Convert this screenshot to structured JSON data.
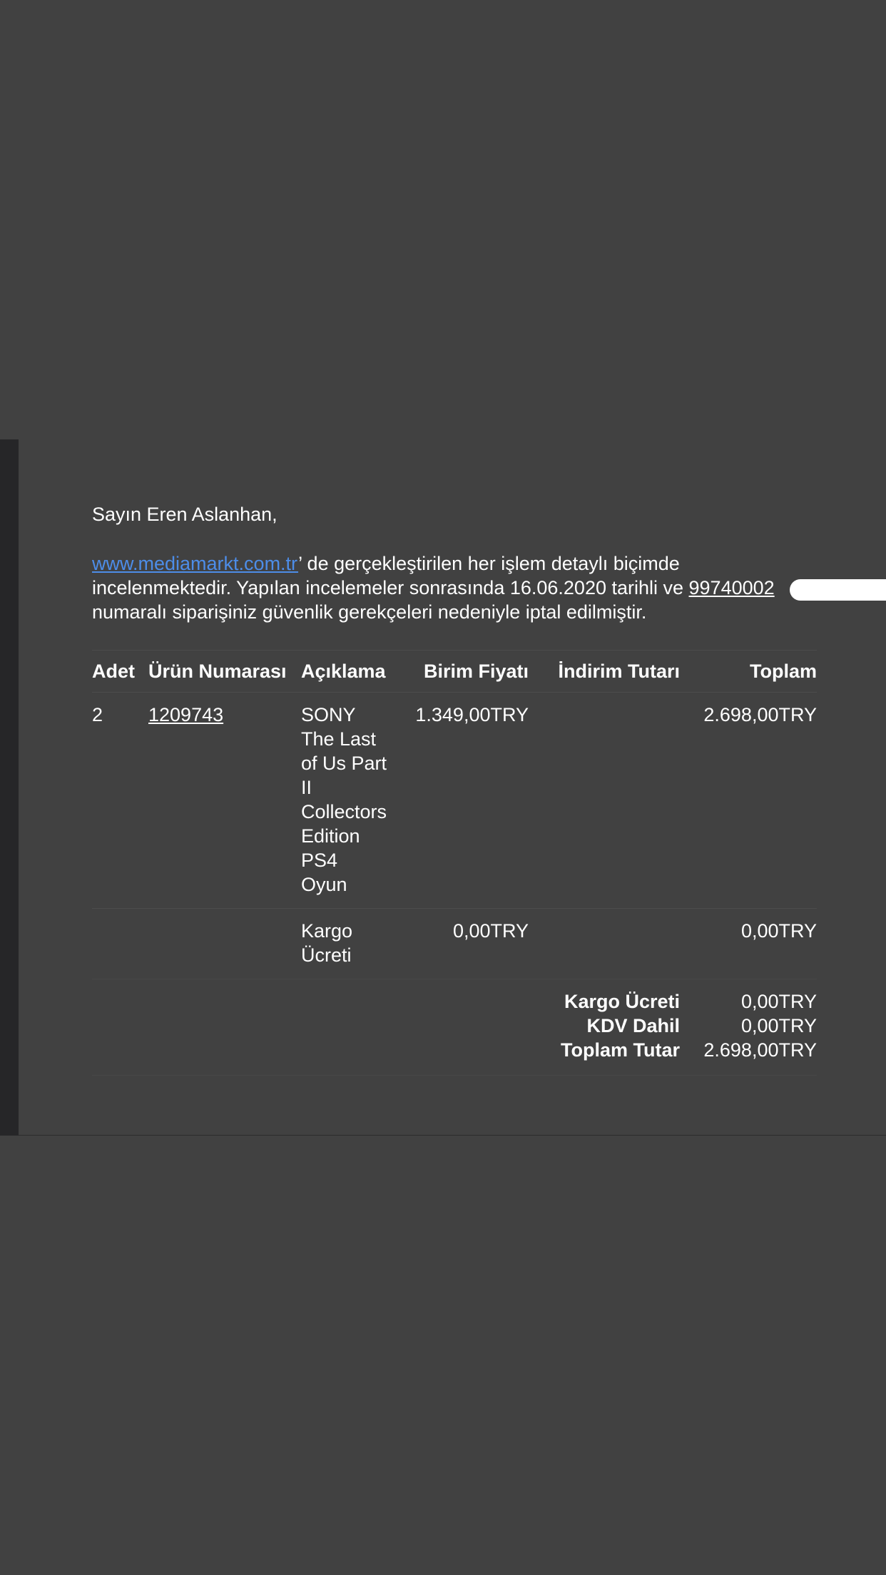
{
  "email": {
    "greeting": "Sayın Eren Aslanhan,",
    "link_text": "www.mediamarkt.com.tr",
    "text_1": "’ de gerçekleştirilen her işlem detaylı biçimde incelenmektedir. Yapılan incelemeler sonrasında 16.06.2020 tarihli ve ",
    "order_number": "99740002",
    "text_2": " numaralı siparişiniz güvenlik gerekçeleri nedeniyle iptal edilmiştir."
  },
  "table": {
    "headers": {
      "adet": "Adet",
      "urun": "Ürün Numarası",
      "aciklama": "Açıklama",
      "birim": "Birim Fiyatı",
      "indirim": "İndirim Tutarı",
      "toplam": "Toplam"
    },
    "rows": [
      {
        "adet": "2",
        "urun": "1209743",
        "aciklama": [
          "SONY",
          "The Last",
          "of Us Part",
          "II",
          "Collectors",
          "Edition",
          "PS4",
          "Oyun"
        ],
        "birim": "1.349,00TRY",
        "indirim": "",
        "toplam": "2.698,00TRY"
      },
      {
        "adet": "",
        "urun": "",
        "aciklama": [
          "Kargo",
          "Ücreti"
        ],
        "birim": "0,00TRY",
        "indirim": "",
        "toplam": "0,00TRY"
      }
    ]
  },
  "totals": [
    {
      "label": "Kargo Ücreti",
      "value": "0,00TRY"
    },
    {
      "label": "KDV Dahil",
      "value": "0,00TRY"
    },
    {
      "label": "Toplam Tutar",
      "value": "2.698,00TRY"
    }
  ]
}
